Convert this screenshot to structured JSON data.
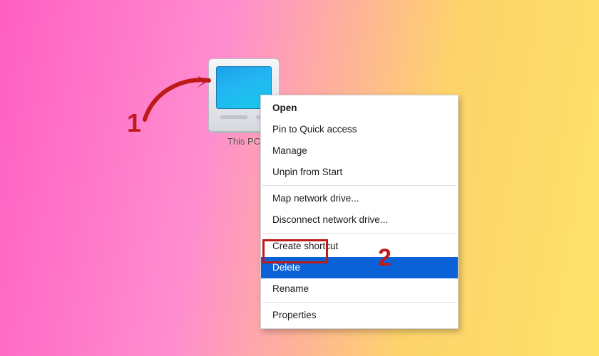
{
  "desktop_icon": {
    "name": "computer-icon",
    "label": "This PC"
  },
  "annotations": {
    "step1": "1",
    "step2": "2"
  },
  "colors": {
    "annotation_red": "#be1a1a",
    "highlight_blue": "#0a62d6"
  },
  "context_menu": {
    "groups": [
      [
        "Open",
        "Pin to Quick access",
        "Manage",
        "Unpin from Start"
      ],
      [
        "Map network drive...",
        "Disconnect network drive..."
      ],
      [
        "Create shortcut",
        "Delete",
        "Rename"
      ],
      [
        "Properties"
      ]
    ],
    "bold_item": "Open",
    "highlighted_item": "Delete",
    "items": {
      "open": "Open",
      "pin_quick_access": "Pin to Quick access",
      "manage": "Manage",
      "unpin_start": "Unpin from Start",
      "map_drive": "Map network drive...",
      "disconnect_drive": "Disconnect network drive...",
      "create_shortcut": "Create shortcut",
      "delete": "Delete",
      "rename": "Rename",
      "properties": "Properties"
    }
  }
}
